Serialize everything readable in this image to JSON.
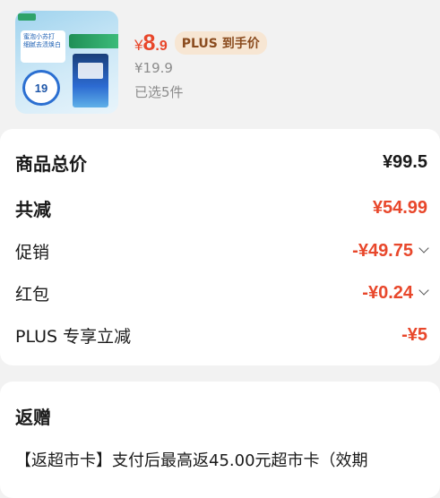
{
  "product": {
    "image_badge_text": "蜜泡小苏打 细腻去渍焕白",
    "image_price": "19",
    "price_symbol": "¥",
    "price_int": "8",
    "price_dec": ".9",
    "plus_tag": "PLUS 到手价",
    "original_price": "¥19.9",
    "selected_count": "已选5件"
  },
  "summary": {
    "rows": [
      {
        "label": "商品总价",
        "value": "¥99.5"
      },
      {
        "label": "共减",
        "value": "¥54.99"
      },
      {
        "label": "促销",
        "value": "-¥49.75"
      },
      {
        "label": "红包",
        "value": "-¥0.24"
      },
      {
        "label": "PLUS 专享立减",
        "value": "-¥5"
      }
    ]
  },
  "gift": {
    "title": "返赠",
    "text": "【返超市卡】支付后最高返45.00元超市卡（效期"
  },
  "colors": {
    "accent_red": "#e8472b",
    "plus_tag_bg": "#f7e6d3",
    "page_bg": "#f2f2f2"
  }
}
